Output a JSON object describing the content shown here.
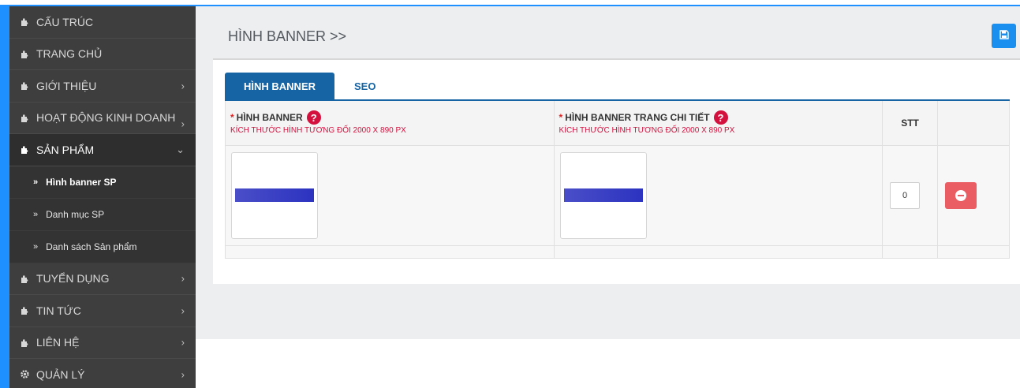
{
  "sidebar": {
    "items": [
      {
        "label": "CẤU TRÚC",
        "icon": "puzzle-icon",
        "chevron": false
      },
      {
        "label": "TRANG CHỦ",
        "icon": "puzzle-icon",
        "chevron": false
      },
      {
        "label": "GIỚI THIỆU",
        "icon": "puzzle-icon",
        "chevron": true
      },
      {
        "label": "HOẠT ĐỘNG KINH DOANH",
        "icon": "puzzle-icon",
        "chevron": true
      },
      {
        "label": "SẢN PHẨM",
        "icon": "puzzle-icon",
        "chevron": "down"
      },
      {
        "label": "TUYỂN DỤNG",
        "icon": "puzzle-icon",
        "chevron": true
      },
      {
        "label": "TIN TỨC",
        "icon": "puzzle-icon",
        "chevron": true
      },
      {
        "label": "LIÊN HỆ",
        "icon": "puzzle-icon",
        "chevron": true
      },
      {
        "label": "QUẢN LÝ",
        "icon": "gear-icon",
        "chevron": true
      }
    ],
    "sub_items": [
      {
        "label": "Hình banner SP",
        "current": true
      },
      {
        "label": "Danh mục SP",
        "current": false
      },
      {
        "label": "Danh sách Sản phẩm",
        "current": false
      }
    ],
    "chevron_right": "›",
    "chevron_down": "⌄",
    "sub_marker": "»"
  },
  "header": {
    "title": "HÌNH BANNER >>",
    "save_icon": "save-icon"
  },
  "tabs": [
    {
      "label": "HÌNH BANNER",
      "active": true
    },
    {
      "label": "SEO",
      "active": false
    }
  ],
  "table": {
    "col1_title": "HÌNH BANNER",
    "col1_sub": "KÍCH THƯỚC HÌNH TƯƠNG ĐỐI 2000 X 890 PX",
    "col2_title": "HÌNH BANNER TRANG CHI TIẾT",
    "col2_sub": "KÍCH THƯỚC HÌNH TƯƠNG ĐỐI 2000 X 890 PX",
    "col3_title": "STT",
    "required_mark": "*",
    "help_mark": "?",
    "rows": [
      {
        "stt": "0"
      }
    ]
  },
  "colors": {
    "accent": "#1664a4",
    "save_button": "#1b8ff0",
    "delete_button": "#ea5d63",
    "required": "#d4113e",
    "sidebar_bg": "#3e3e3e"
  }
}
